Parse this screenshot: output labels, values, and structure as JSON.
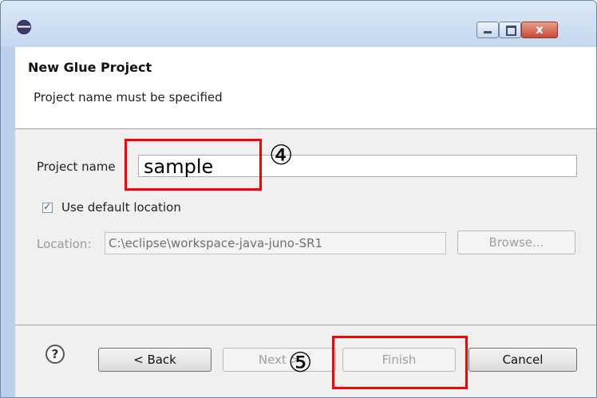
{
  "window": {
    "close_glyph": "x",
    "colors": {
      "close_button": "#c94a33",
      "annotation": "#ff0000"
    }
  },
  "header": {
    "title": "New Glue Project",
    "message": "Project name must be specified"
  },
  "form": {
    "project_name_label": "Project name",
    "project_name_value": "sample",
    "use_default_label": "Use default location",
    "use_default_checked": true,
    "location_label": "Location:",
    "location_value": "C:\\eclipse\\workspace-java-juno-SR1",
    "browse_label": "Browse..."
  },
  "footer": {
    "help_glyph": "?",
    "back_label": "< Back",
    "next_label": "Next >",
    "finish_label": "Finish",
    "cancel_label": "Cancel"
  },
  "annotations": {
    "step4": "④",
    "step5": "⑤"
  }
}
